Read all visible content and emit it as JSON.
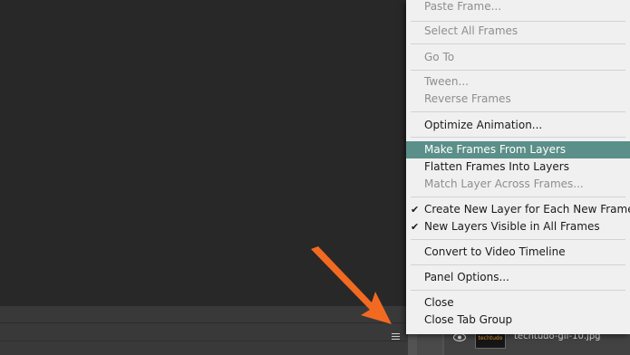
{
  "menu": {
    "items": [
      {
        "label": "Paste Frame...",
        "state": "disabled"
      },
      {
        "label": "Select All Frames",
        "state": "disabled"
      },
      {
        "label": "Go To",
        "state": "disabled"
      },
      {
        "label": "Tween...",
        "state": "disabled"
      },
      {
        "label": "Reverse Frames",
        "state": "disabled"
      },
      {
        "label": "Optimize Animation...",
        "state": "enabled"
      },
      {
        "label": "Make Frames From Layers",
        "state": "highlighted"
      },
      {
        "label": "Flatten Frames Into Layers",
        "state": "enabled"
      },
      {
        "label": "Match Layer Across Frames...",
        "state": "disabled"
      },
      {
        "label": "Create New Layer for Each New Frame",
        "state": "checked"
      },
      {
        "label": "New Layers Visible in All Frames",
        "state": "checked"
      },
      {
        "label": "Convert to Video Timeline",
        "state": "enabled"
      },
      {
        "label": "Panel Options...",
        "state": "enabled"
      },
      {
        "label": "Close",
        "state": "enabled"
      },
      {
        "label": "Close Tab Group",
        "state": "enabled"
      }
    ],
    "check_glyph": "✔",
    "highlight_color": "#5b8f89"
  },
  "layers": {
    "row_name": "techtudo-gif-10.jpg",
    "thumb_text": "techtudo"
  },
  "icons": {
    "panel_menu": "hamburger-icon",
    "visibility": "eye-icon",
    "submenu": "triangle-right-icon",
    "annotation": "orange-arrow"
  },
  "colors": {
    "arrow": "#f26a21",
    "menu_bg": "#f0f0f0",
    "workspace": "#282828"
  }
}
